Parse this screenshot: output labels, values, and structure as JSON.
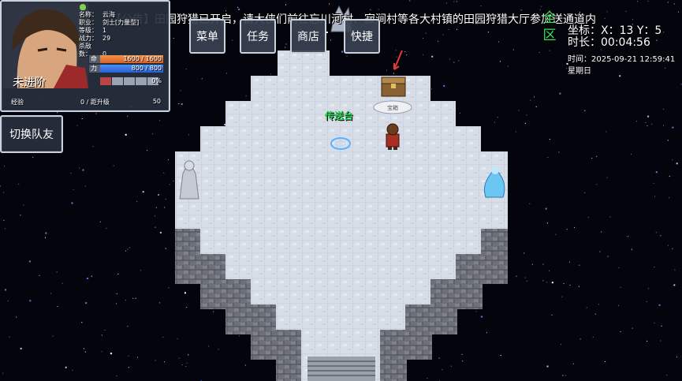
{
  "hud": {
    "name_label": "名称：",
    "name_value": "云海",
    "class_label": "职业：",
    "class_value": "剑士[力量型]",
    "level_label": "等级：",
    "level_value": "1",
    "power_label": "战力：",
    "power_value": "29",
    "kills_label": "杀敌数：",
    "kills_value": "0",
    "rank": "未进阶",
    "hp_label": "命",
    "hp_value": "1600 / 1600",
    "hp_ratio": 1.0,
    "mp_label": "力",
    "mp_value": "800 / 800",
    "mp_ratio": 1.0,
    "rage_value": "0%",
    "exp_label": "经验",
    "exp_value": "0 / 距升级",
    "exp_next": "50"
  },
  "buttons": {
    "switch_party": "切换队友",
    "menu": "菜单",
    "quest": "任务",
    "shop": "商店",
    "shortcut": "快捷"
  },
  "announcement": "【公告】田园狩猎已开启，请大侠们前往忘川河村、寂涧村等各大村镇的田园狩猎大厅参加送通道内",
  "zone_label": [
    "全",
    "区"
  ],
  "coords_label": "坐标：X：13 Y：5",
  "playtime_label": "时长：00:04:56",
  "datetime_label": "时间：2025-09-21 12:59:41 星期日",
  "map": {
    "teleport_label": "传送台",
    "sign_text": "宝箱"
  },
  "colors": {
    "floor": "#d9dfe8",
    "wall": "#7d8088",
    "zone_green": "#3de05a",
    "teleport_green": "#2fd35a"
  }
}
